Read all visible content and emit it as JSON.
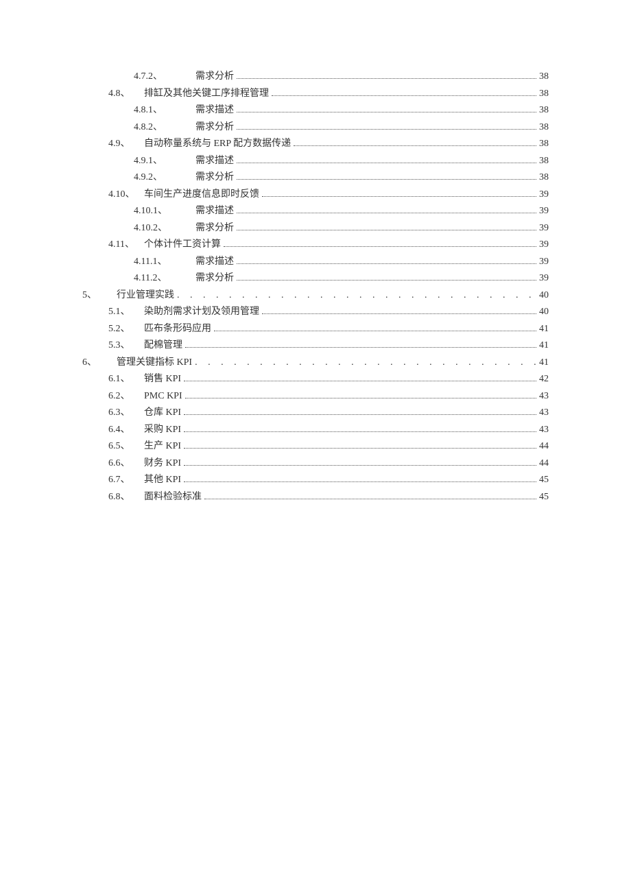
{
  "toc": [
    {
      "level": 3,
      "number": "4.7.2、",
      "title": "需求分析",
      "page": "38",
      "dotstyle": "normal"
    },
    {
      "level": 2,
      "number": "4.8、",
      "title": "排缸及其他关键工序排程管理",
      "page": "38",
      "dotstyle": "normal"
    },
    {
      "level": 3,
      "number": "4.8.1、",
      "title": "需求描述",
      "page": "38",
      "dotstyle": "normal"
    },
    {
      "level": 3,
      "number": "4.8.2、",
      "title": "需求分析",
      "page": "38",
      "dotstyle": "normal"
    },
    {
      "level": 2,
      "number": "4.9、",
      "title": "自动称量系统与 ERP 配方数据传递",
      "page": "38",
      "dotstyle": "normal"
    },
    {
      "level": 3,
      "number": "4.9.1、",
      "title": "需求描述",
      "page": "38",
      "dotstyle": "normal"
    },
    {
      "level": 3,
      "number": "4.9.2、",
      "title": "需求分析",
      "page": "38",
      "dotstyle": "normal"
    },
    {
      "level": 2,
      "number": "4.10、",
      "title": "车间生产进度信息即时反馈",
      "page": "39",
      "dotstyle": "normal"
    },
    {
      "level": 3,
      "number": "4.10.1、",
      "title": "需求描述",
      "page": "39",
      "dotstyle": "normal"
    },
    {
      "level": 3,
      "number": "4.10.2、",
      "title": "需求分析",
      "page": "39",
      "dotstyle": "normal"
    },
    {
      "level": 2,
      "number": "4.11、",
      "title": "个体计件工资计算",
      "page": "39",
      "dotstyle": "normal"
    },
    {
      "level": 3,
      "number": "4.11.1、",
      "title": "需求描述",
      "page": "39",
      "dotstyle": "normal"
    },
    {
      "level": 3,
      "number": "4.11.2、",
      "title": "需求分析",
      "page": "39",
      "dotstyle": "normal"
    },
    {
      "level": 1,
      "number": "5、",
      "title": "行业管理实践",
      "page": "40",
      "dotstyle": "spaced"
    },
    {
      "level": 2,
      "number": "5.1、",
      "title": "染助剂需求计划及领用管理",
      "page": "40",
      "dotstyle": "normal"
    },
    {
      "level": 2,
      "number": "5.2、",
      "title": "匹布条形码应用",
      "page": "41",
      "dotstyle": "normal"
    },
    {
      "level": 2,
      "number": "5.3、",
      "title": "配棉管理",
      "page": "41",
      "dotstyle": "normal"
    },
    {
      "level": 1,
      "number": "6、",
      "title": "管理关键指标 KPI",
      "page": "41",
      "dotstyle": "spaced"
    },
    {
      "level": 2,
      "number": "6.1、",
      "title": "销售  KPI",
      "page": "42",
      "dotstyle": "normal"
    },
    {
      "level": 2,
      "number": "6.2、",
      "title": "PMC KPI",
      "page": "43",
      "dotstyle": "normal"
    },
    {
      "level": 2,
      "number": "6.3、",
      "title": "仓库  KPI",
      "page": "43",
      "dotstyle": "normal"
    },
    {
      "level": 2,
      "number": "6.4、",
      "title": "采购  KPI",
      "page": "43",
      "dotstyle": "normal"
    },
    {
      "level": 2,
      "number": "6.5、",
      "title": "生产  KPI",
      "page": "44",
      "dotstyle": "normal"
    },
    {
      "level": 2,
      "number": "6.6、",
      "title": "财务  KPI",
      "page": "44",
      "dotstyle": "normal"
    },
    {
      "level": 2,
      "number": "6.7、",
      "title": "其他  KPI",
      "page": "45",
      "dotstyle": "normal"
    },
    {
      "level": 2,
      "number": "6.8、",
      "title": "面料检验标准",
      "page": "45",
      "dotstyle": "normal"
    }
  ],
  "spaced_dots": ". . . . . . . . . . . . . . . . . . . . . . . . . . . . . . . . . . . . . . . . . . . . . . . . . . . . . . . . . . . . . . . . . . . . . . . . . . . . . . . . . . . . . . . . . . ."
}
